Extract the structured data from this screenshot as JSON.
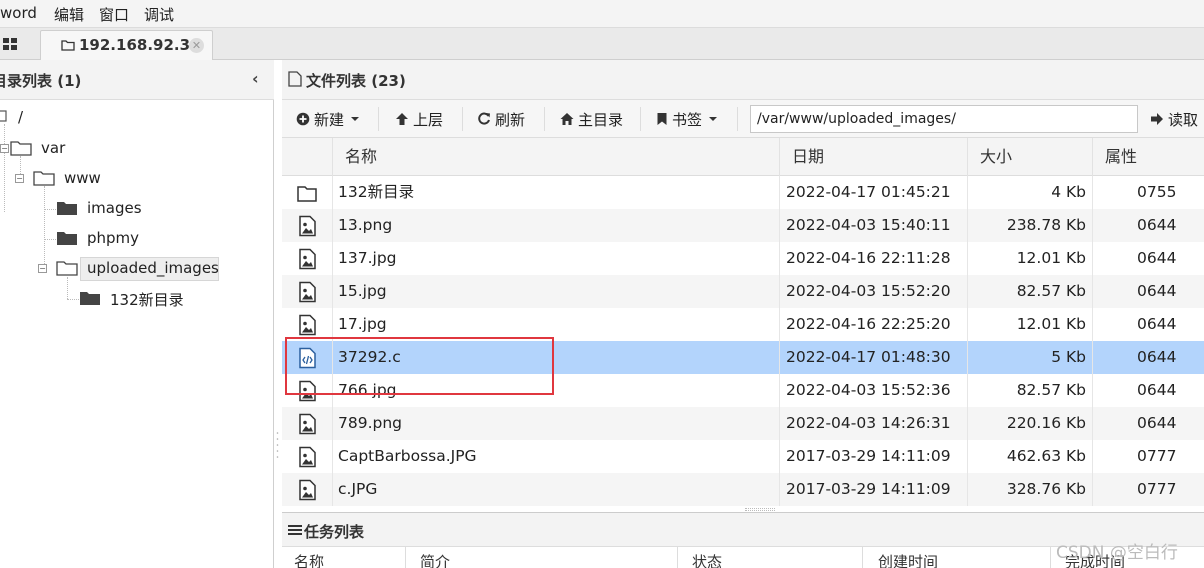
{
  "menu": [
    "word",
    "编辑",
    "窗口",
    "调试"
  ],
  "tab": {
    "title": "192.168.92.3"
  },
  "left_panel": {
    "title": "目录列表 (1)",
    "tree": {
      "root": "/",
      "var": "var",
      "www": "www",
      "images": "images",
      "phpmy": "phpmy",
      "uploaded": "uploaded_images",
      "newdir": "132新目录"
    }
  },
  "file_panel": {
    "title": "文件列表 (23)",
    "toolbar": {
      "new": "新建",
      "up": "上层",
      "refresh": "刷新",
      "home": "主目录",
      "bookmark": "书签",
      "path": "/var/www/uploaded_images/",
      "read": "读取"
    },
    "columns": {
      "name": "名称",
      "date": "日期",
      "size": "大小",
      "attr": "属性"
    },
    "rows": [
      {
        "name": "132新目录",
        "date": "2022-04-17 01:45:21",
        "size": "4 Kb",
        "attr": "0755",
        "icon": "folder-icon"
      },
      {
        "name": "13.png",
        "date": "2022-04-03 15:40:11",
        "size": "238.78 Kb",
        "attr": "0644",
        "icon": "image-file-icon"
      },
      {
        "name": "137.jpg",
        "date": "2022-04-16 22:11:28",
        "size": "12.01 Kb",
        "attr": "0644",
        "icon": "image-file-icon"
      },
      {
        "name": "15.jpg",
        "date": "2022-04-03 15:52:20",
        "size": "82.57 Kb",
        "attr": "0644",
        "icon": "image-file-icon"
      },
      {
        "name": "17.jpg",
        "date": "2022-04-16 22:25:20",
        "size": "12.01 Kb",
        "attr": "0644",
        "icon": "image-file-icon"
      },
      {
        "name": "37292.c",
        "date": "2022-04-17 01:48:30",
        "size": "5 Kb",
        "attr": "0644",
        "icon": "code-file-icon",
        "selected": true
      },
      {
        "name": "766.jpg",
        "date": "2022-04-03 15:52:36",
        "size": "82.57 Kb",
        "attr": "0644",
        "icon": "image-file-icon"
      },
      {
        "name": "789.png",
        "date": "2022-04-03 14:26:31",
        "size": "220.16 Kb",
        "attr": "0644",
        "icon": "image-file-icon"
      },
      {
        "name": "CaptBarbossa.JPG",
        "date": "2017-03-29 14:11:09",
        "size": "462.63 Kb",
        "attr": "0777",
        "icon": "image-file-icon"
      },
      {
        "name": "c.JPG",
        "date": "2017-03-29 14:11:09",
        "size": "328.76 Kb",
        "attr": "0777",
        "icon": "image-file-icon"
      }
    ]
  },
  "task_panel": {
    "title": "任务列表",
    "columns": [
      "名称",
      "简介",
      "状态",
      "创建时间",
      "完成时间"
    ]
  },
  "watermark": "CSDN @空白行",
  "colors": {
    "selected_row": "#b3d4fc",
    "highlight_box": "#e0373f"
  }
}
